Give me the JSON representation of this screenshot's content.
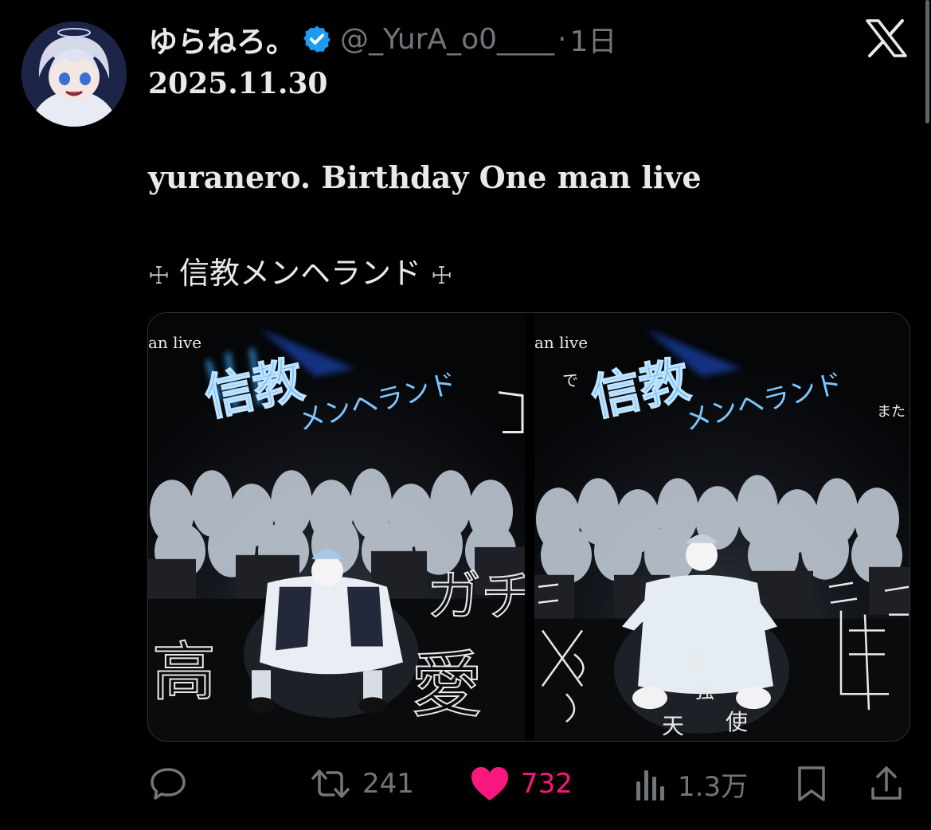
{
  "post": {
    "author": {
      "display_name": "ゆらねろ。",
      "verified": true,
      "handle": "@_YurA_o0____",
      "time": "1日"
    },
    "lines": {
      "date": "2025.11.30",
      "title": "yuranero. Birthday One man live",
      "tag_left": "☩",
      "tag_text": "信教メンヘランド",
      "tag_right": "☩"
    },
    "media": {
      "left": {
        "caption": "an live",
        "logo_main": "信教",
        "logo_sub": "メンヘランド",
        "scribbles": [
          "高",
          "ガチ",
          "愛"
        ]
      },
      "right": {
        "caption": "an live",
        "logo_main": "信教",
        "logo_sub": "メンヘランド",
        "scribbles": [
          "で",
          "また",
          "最",
          "強",
          "天",
          "使"
        ]
      }
    },
    "actions": {
      "reply_icon": "reply-icon",
      "retweet_count": "241",
      "like_count": "732",
      "views_count": "1.3万",
      "bookmark_icon": "bookmark-icon",
      "share_icon": "share-icon"
    }
  },
  "colors": {
    "background": "#000000",
    "text": "#e7e9ea",
    "muted": "#71767b",
    "like": "#f91880",
    "verified": "#1d9bf0",
    "neon": "#3aa8ff"
  }
}
